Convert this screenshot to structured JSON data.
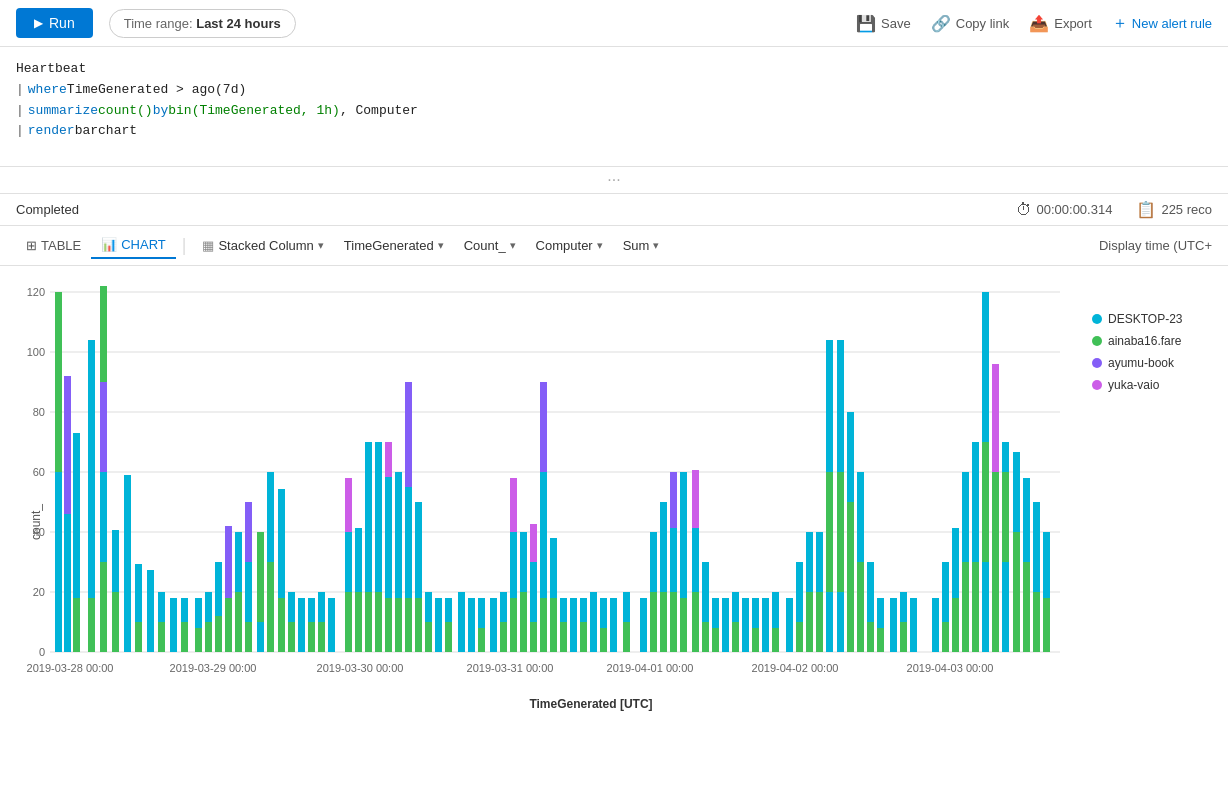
{
  "toolbar": {
    "run_label": "Run",
    "time_range_label": "Time range:",
    "time_range_value": "Last 24 hours",
    "save_label": "Save",
    "copy_link_label": "Copy link",
    "export_label": "Export",
    "new_alert_label": "New alert rule"
  },
  "query": {
    "line1": "Heartbeat",
    "line2_pipe": "|",
    "line2_kw": "where",
    "line2_rest": " TimeGenerated > ago(7d)",
    "line3_pipe": "|",
    "line3_kw1": "summarize",
    "line3_fn": "count()",
    "line3_kw2": " by ",
    "line3_fn2": "bin(TimeGenerated, 1h)",
    "line3_rest": ", Computer",
    "line4_pipe": "|",
    "line4_kw": "render",
    "line4_rest": " barchart"
  },
  "status": {
    "label": "Completed",
    "time": "00:00:00.314",
    "records": "225 reco"
  },
  "chart_toolbar": {
    "table_label": "TABLE",
    "chart_label": "CHART",
    "chart_type": "Stacked Column",
    "x_axis": "TimeGenerated",
    "y_axis": "Count_",
    "split": "Computer",
    "agg": "Sum",
    "display_time": "Display time (UTC+"
  },
  "legend": {
    "items": [
      {
        "label": "DESKTOP-23",
        "color": "#00b4d8"
      },
      {
        "label": "ainaba16.fare",
        "color": "#40c057"
      },
      {
        "label": "ayumu-book",
        "color": "#845ef7"
      },
      {
        "label": "yuka-vaio",
        "color": "#cc5de8"
      }
    ]
  },
  "chart": {
    "y_label": "count_",
    "x_label": "TimeGenerated [UTC]",
    "y_max": 120,
    "y_ticks": [
      0,
      20,
      40,
      60,
      80,
      100,
      120
    ],
    "x_labels": [
      "2019-03-28 00:00",
      "2019-03-29 00:00",
      "2019-03-30 00:00",
      "2019-03-31 00:00",
      "2019-04-01 00:00",
      "2019-04-02 00:00",
      "2019-04-03 00:00"
    ]
  }
}
